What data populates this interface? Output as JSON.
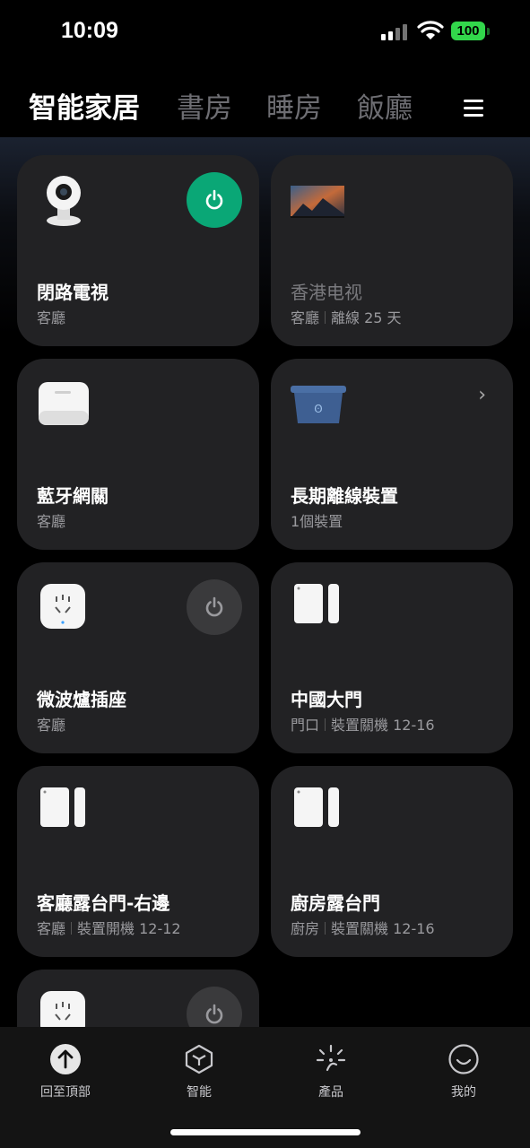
{
  "status_bar": {
    "time": "10:09",
    "battery": "100"
  },
  "tabs": [
    "智能家居",
    "書房",
    "睡房",
    "飯廳"
  ],
  "devices": [
    {
      "name": "閉路電視",
      "room": "客廳",
      "status": "",
      "power": "on",
      "icon": "camera-icon"
    },
    {
      "name": "香港电视",
      "room": "客廳",
      "status": "離線 25 天",
      "power": "",
      "icon": "tv-icon"
    },
    {
      "name": "藍牙網關",
      "room": "客廳",
      "status": "",
      "power": "",
      "icon": "gateway-icon"
    },
    {
      "name": "長期離線裝置",
      "room": "1個裝置",
      "status": "",
      "power": "",
      "icon": "offline-box-icon"
    },
    {
      "name": "微波爐插座",
      "room": "客廳",
      "status": "",
      "power": "off",
      "icon": "plug-icon"
    },
    {
      "name": "中國大門",
      "room": "門口",
      "status": "裝置關機 12-16",
      "power": "",
      "icon": "door-sensor-icon"
    },
    {
      "name": "客廳露台門-右邊",
      "room": "客廳",
      "status": "裝置開機 12-12",
      "power": "",
      "icon": "door-sensor-icon"
    },
    {
      "name": "廚房露台門",
      "room": "廚房",
      "status": "裝置關機 12-16",
      "power": "",
      "icon": "door-sensor-icon"
    }
  ],
  "tab_bar": [
    {
      "label": "回至頂部",
      "icon": "arrow-up-icon"
    },
    {
      "label": "智能",
      "icon": "cube-icon"
    },
    {
      "label": "產品",
      "icon": "product-icon"
    },
    {
      "label": "我的",
      "icon": "profile-icon"
    }
  ],
  "colors": {
    "accent": "#0aa776",
    "battery": "#32d74b",
    "card": "#222224"
  }
}
